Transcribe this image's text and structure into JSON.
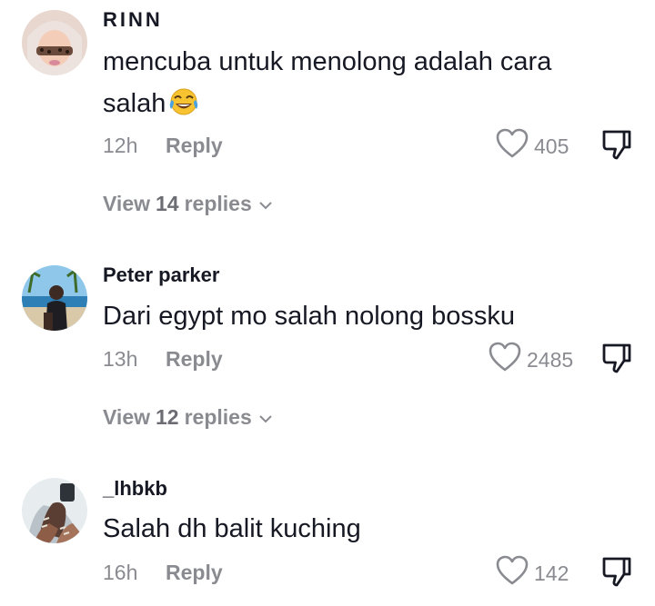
{
  "comments": [
    {
      "username": "RINN",
      "text": "mencuba untuk menolong adalah cara salah",
      "emoji_icon": "face-with-tears-of-joy-icon",
      "time": "12h",
      "reply_label": "Reply",
      "likes": "405",
      "view_replies": {
        "prefix": "View",
        "count": "14",
        "suffix": "replies"
      }
    },
    {
      "username": "Peter parker",
      "text": "Dari egypt mo salah nolong bossku",
      "time": "13h",
      "reply_label": "Reply",
      "likes": "2485",
      "view_replies": {
        "prefix": "View",
        "count": "12",
        "suffix": "replies"
      }
    },
    {
      "username": "_lhbkb",
      "text": "Salah dh balit kuching",
      "time": "16h",
      "reply_label": "Reply",
      "likes": "142"
    }
  ],
  "icons": {
    "like": "heart-outline-icon",
    "dislike": "thumbs-down-icon",
    "expand": "chevron-down-icon"
  },
  "colors": {
    "text": "#161823",
    "muted": "#8a8b91"
  }
}
